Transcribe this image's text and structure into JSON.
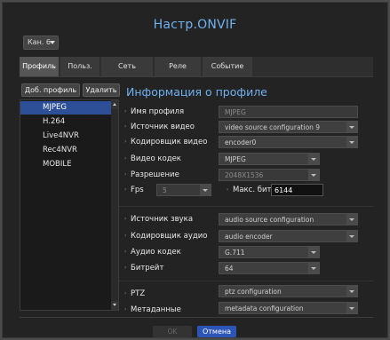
{
  "window": {
    "title": "Настр.ONVIF"
  },
  "channel": {
    "value": "Кан. 6"
  },
  "tabs": [
    {
      "label": "Профиль",
      "active": true
    },
    {
      "label": "Польз.",
      "active": false
    },
    {
      "label": "Сеть",
      "active": false
    },
    {
      "label": "Реле",
      "active": false
    },
    {
      "label": "Событие",
      "active": false
    }
  ],
  "profile_buttons": {
    "add": "Доб. профиль",
    "delete": "Удалить"
  },
  "profiles": [
    "MJPEG",
    "H.264",
    "Live4NVR",
    "Rec4NVR",
    "MOBILE"
  ],
  "selected_profile": "MJPEG",
  "section_title": "Информация о профиле",
  "video": {
    "profile_name_label": "Имя профиля",
    "profile_name_value": "MJPEG",
    "video_source_label": "Источник видео",
    "video_source_value": "video source configuration 9",
    "video_encoder_label": "Кодировщик видео",
    "video_encoder_value": "encoder0",
    "video_codec_label": "Видео кодек",
    "video_codec_value": "MJPEG",
    "resolution_label": "Разрешение",
    "resolution_value": "2048X1536",
    "fps_label": "Fps",
    "fps_value": "5",
    "max_bitrate_label": "Макс. битр.",
    "max_bitrate_value": "6144"
  },
  "audio": {
    "audio_source_label": "Источник звука",
    "audio_source_value": "audio source configuration",
    "audio_encoder_label": "Кодировщик аудио",
    "audio_encoder_value": "audio encoder",
    "audio_codec_label": "Аудио кодек",
    "audio_codec_value": "G.711",
    "bitrate_label": "Битрейт",
    "bitrate_value": "64"
  },
  "misc": {
    "ptz_label": "PTZ",
    "ptz_value": "ptz configuration",
    "metadata_label": "Метаданные",
    "metadata_value": "metadata configuration"
  },
  "footer": {
    "ok": "OK",
    "cancel": "Отмена"
  },
  "colors": {
    "accent": "#6fb1f0",
    "selection": "#2d4f97",
    "primary_button": "#2d55b8"
  }
}
